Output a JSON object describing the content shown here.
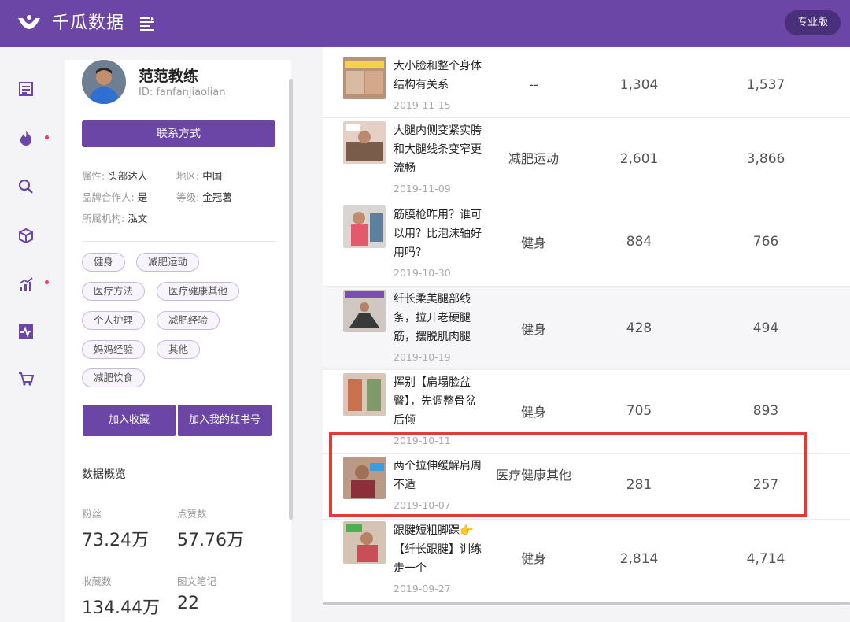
{
  "header": {
    "brand": "千瓜数据",
    "pro_label": "专业版"
  },
  "profile": {
    "name": "范范教练",
    "id_text": "ID: fanfanjiaolian",
    "contact_label": "联系方式",
    "attr_type_key": "属性:",
    "attr_type_val": "头部达人",
    "attr_region_key": "地区:",
    "attr_region_val": "中国",
    "attr_brand_key": "品牌合作人:",
    "attr_brand_val": "是",
    "attr_level_key": "等级:",
    "attr_level_val": "金冠薯",
    "attr_org_key": "所属机构:",
    "attr_org_val": "泓文",
    "tags": [
      "健身",
      "减肥运动",
      "医疗方法",
      "医疗健康其他",
      "个人护理",
      "减肥经验",
      "妈妈经验",
      "其他",
      "减肥饮食"
    ],
    "fav_label": "加入收藏",
    "redbook_label": "加入我的红书号",
    "overview_title": "数据概览",
    "stats": [
      {
        "label": "粉丝",
        "value": "73.24万"
      },
      {
        "label": "点赞数",
        "value": "57.76万"
      },
      {
        "label": "收藏数",
        "value": "134.44万"
      },
      {
        "label": "图文笔记",
        "value": "22"
      }
    ]
  },
  "rows": [
    {
      "title": "大小脸和整个身体结构有关系",
      "date": "2019-11-15",
      "category": "--",
      "n1": "1,304",
      "n2": "1,537"
    },
    {
      "title": "大腿内侧变紧实胯和大腿线条变窄更流畅",
      "date": "2019-11-09",
      "category": "减肥运动",
      "n1": "2,601",
      "n2": "3,866"
    },
    {
      "title": "筋膜枪咋用？谁可以用？比泡沫轴好用吗？",
      "date": "2019-10-30",
      "category": "健身",
      "n1": "884",
      "n2": "766"
    },
    {
      "title": "纤长柔美腿部线条，拉开老硬腿筋，摆脱肌肉腿",
      "date": "2019-10-19",
      "category": "健身",
      "n1": "428",
      "n2": "494"
    },
    {
      "title": "挥别【扁塌脸盆臀】，先调整骨盆后倾",
      "date": "2019-10-11",
      "category": "健身",
      "n1": "705",
      "n2": "893"
    },
    {
      "title": "两个拉伸缓解肩周不适",
      "date": "2019-10-07",
      "category": "医疗健康其他",
      "n1": "281",
      "n2": "257"
    },
    {
      "title": "跟腱短粗脚踝👉【纤长跟腱】训练走一个",
      "date": "2019-09-27",
      "category": "健身",
      "n1": "2,814",
      "n2": "4,714"
    }
  ]
}
